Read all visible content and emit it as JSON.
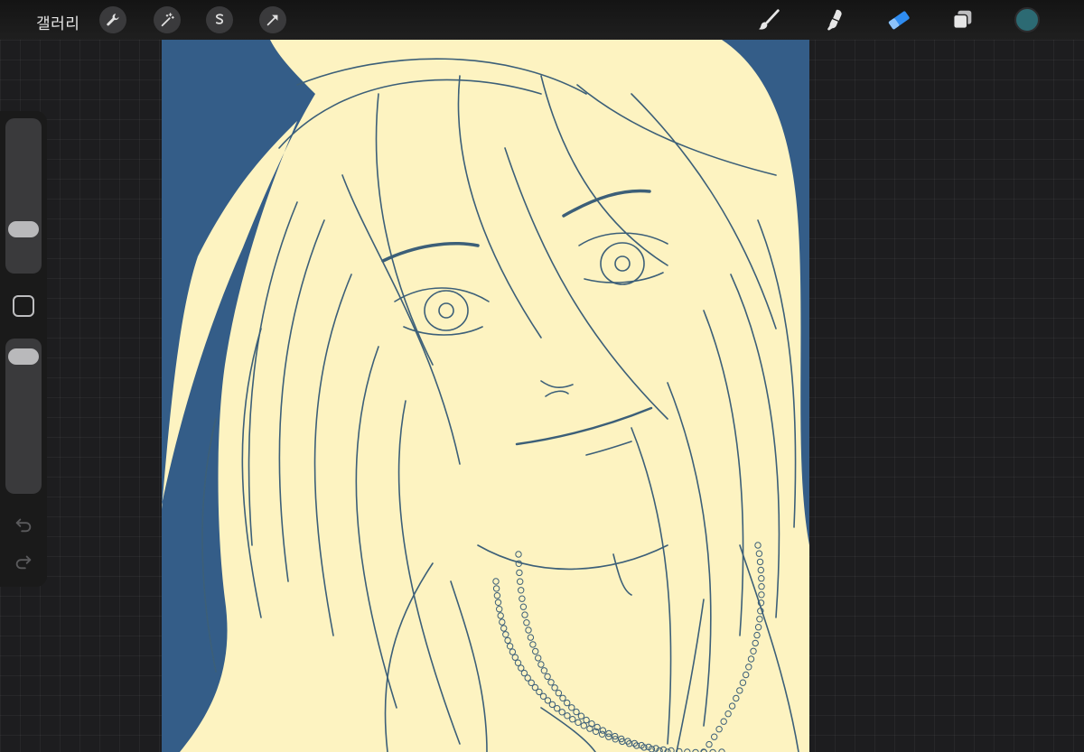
{
  "topbar": {
    "gallery_label": "갤러리",
    "left_tools": [
      "wrench-icon",
      "magic-wand-icon",
      "selection-icon",
      "transform-arrow-icon"
    ],
    "right_tools": [
      "brush-icon",
      "smudge-icon",
      "eraser-icon",
      "layers-icon"
    ],
    "active_tool": "eraser-icon",
    "active_tool_color": "#2f8cf0",
    "current_color": "#2c6a73"
  },
  "sidebar": {
    "brush_size_level": 0.25,
    "opacity_level": 0.05,
    "icons": [
      "modify-square-icon",
      "undo-icon",
      "redo-icon"
    ]
  },
  "canvas": {
    "background_color": "#345d88",
    "fill_color": "#fdf3c1",
    "line_color": "#3c5f78"
  }
}
